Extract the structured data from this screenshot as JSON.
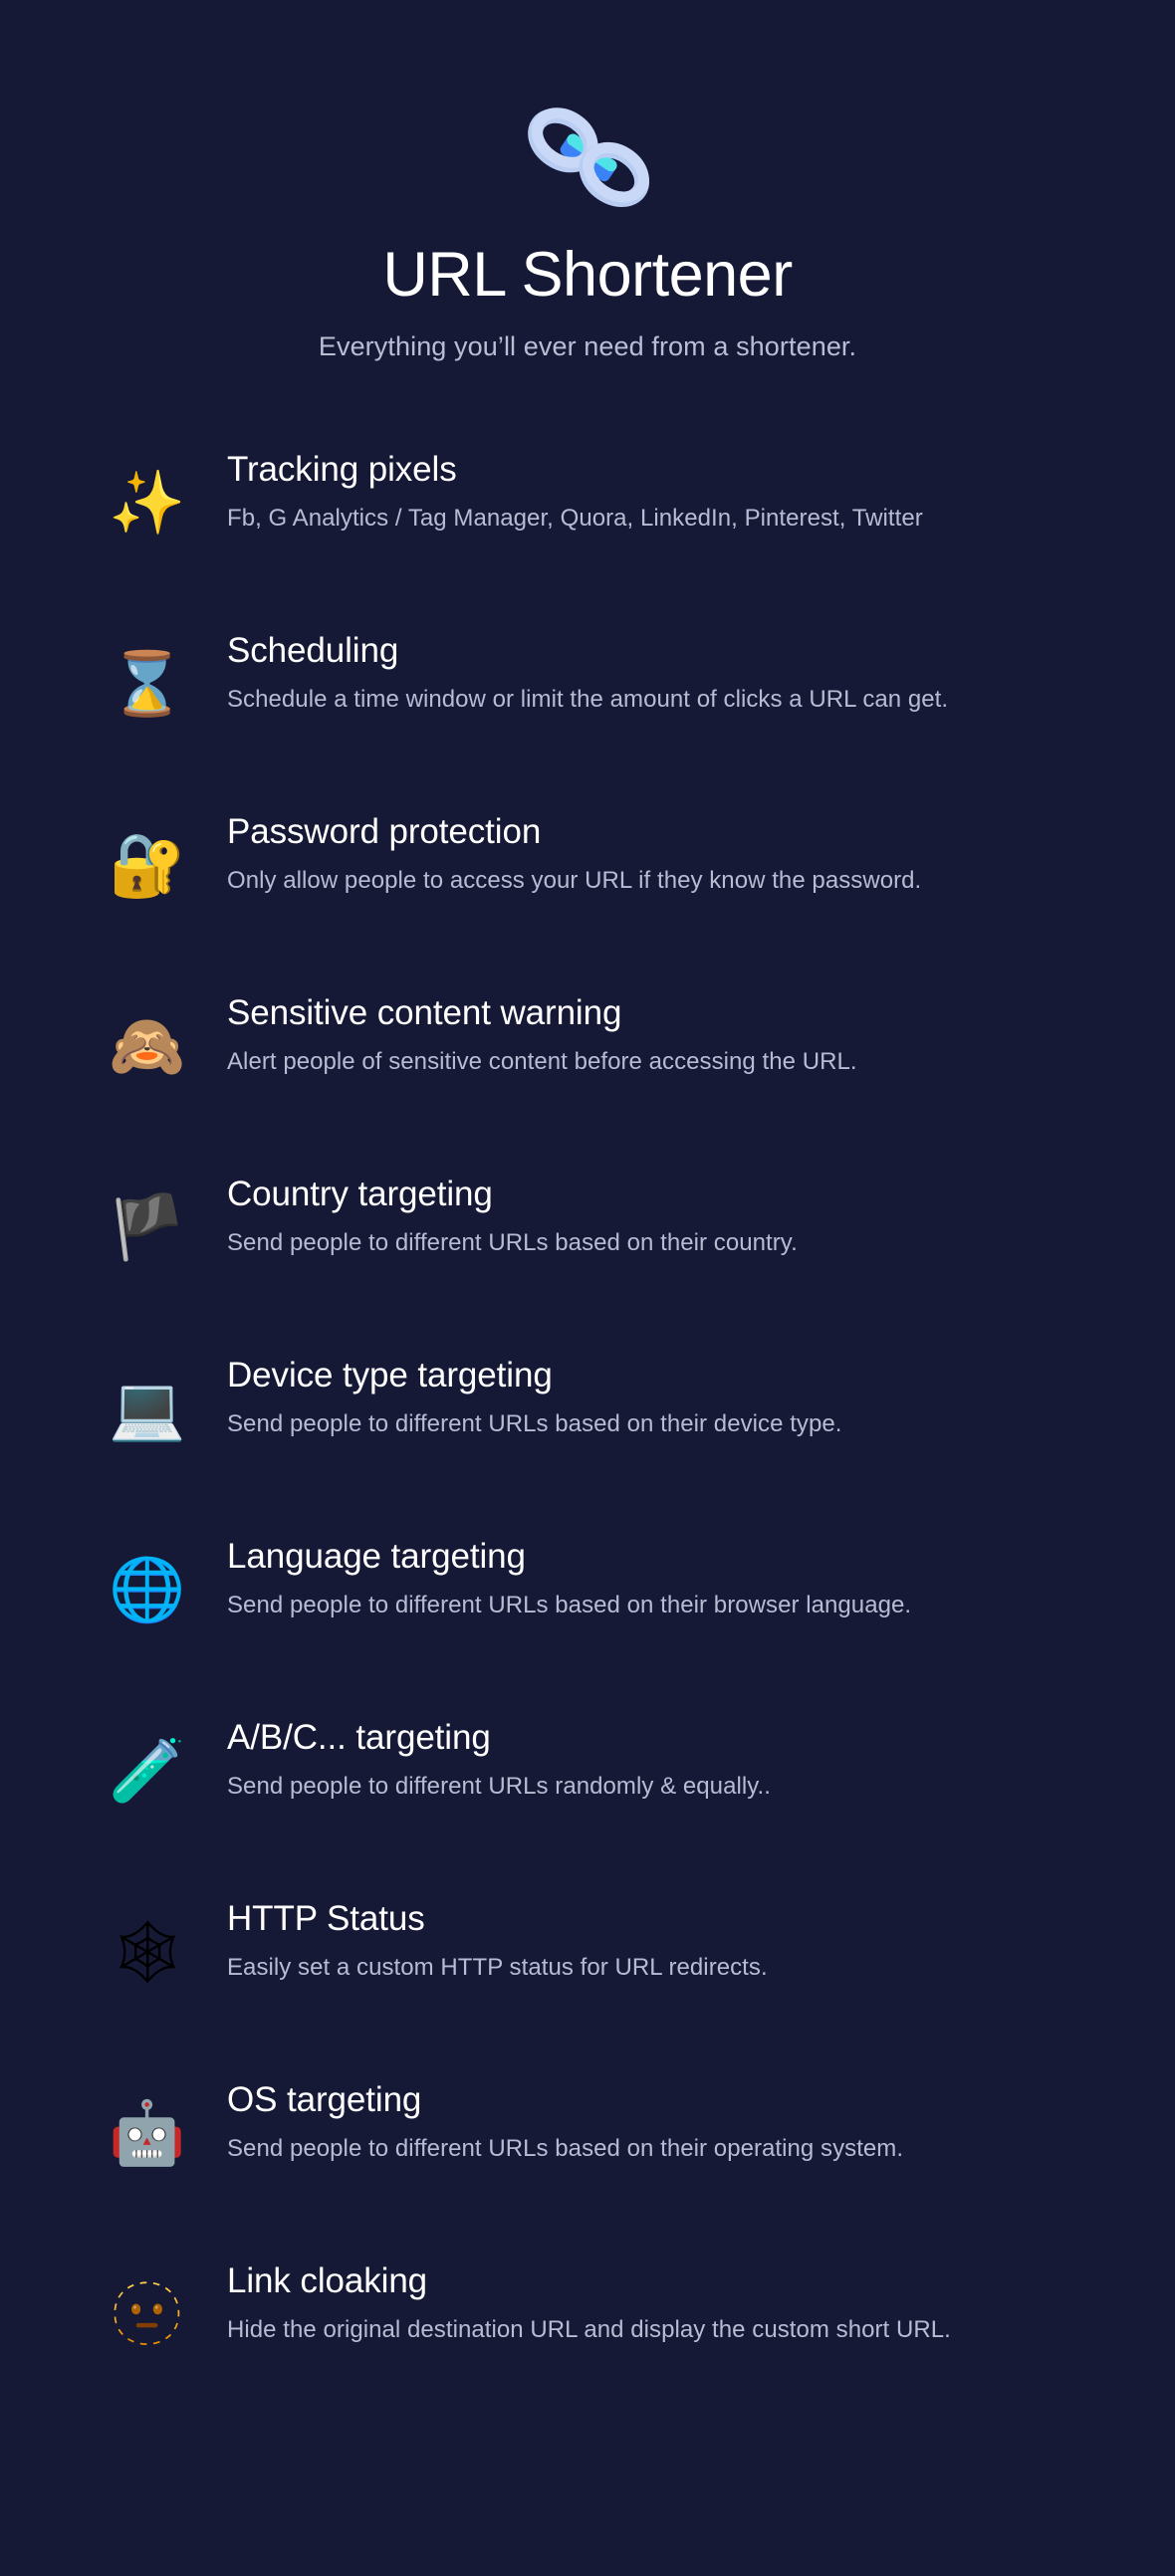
{
  "theme": {
    "background": "#161936",
    "title_color": "#ffffff",
    "subtitle_color": "#b9bed4",
    "description_color": "#b7bcd3",
    "logo_light": "#b9cdf2",
    "logo_mid": "#3b82f6",
    "logo_cyan": "#4fe3e8"
  },
  "header": {
    "logo_icon": "chain-link-icon",
    "title": "URL Shortener",
    "subtitle": "Everything you’ll ever need from a shortener."
  },
  "features": [
    {
      "icon": "sparkles-icon",
      "emoji": "✨",
      "title": "Tracking pixels",
      "description": "Fb, G Analytics / Tag Manager, Quora, LinkedIn, Pinterest, Twitter"
    },
    {
      "icon": "hourglass-icon",
      "emoji": "⌛",
      "title": "Scheduling",
      "description": "Schedule a time window or limit the amount of clicks a URL can get."
    },
    {
      "icon": "locked-with-key-icon",
      "emoji": "🔐",
      "title": "Password protection",
      "description": "Only allow people to access your URL if they know the password."
    },
    {
      "icon": "see-no-evil-monkey-icon",
      "emoji": "🙈",
      "title": "Sensitive content warning",
      "description": "Alert people of sensitive content before accessing the URL."
    },
    {
      "icon": "black-flag-icon",
      "emoji": "🏴",
      "title": "Country targeting",
      "description": "Send people to different URLs based on their country."
    },
    {
      "icon": "laptop-icon",
      "emoji": "💻",
      "title": "Device type targeting",
      "description": "Send people to different URLs based on their device type."
    },
    {
      "icon": "globe-with-meridians-icon",
      "emoji": "🌐",
      "title": "Language targeting",
      "description": "Send people to different URLs based on their browser language."
    },
    {
      "icon": "test-tube-icon",
      "emoji": "🧪",
      "title": "A/B/C... targeting",
      "description": "Send people to different URLs randomly & equally.."
    },
    {
      "icon": "spider-web-icon",
      "emoji": "🕸",
      "title": "HTTP Status",
      "description": "Easily set a custom HTTP status for URL redirects."
    },
    {
      "icon": "robot-icon",
      "emoji": "🤖",
      "title": "OS targeting",
      "description": "Send people to different URLs based on their operating system."
    },
    {
      "icon": "dotted-line-face-icon",
      "emoji": "🫥",
      "title": "Link cloaking",
      "description": "Hide the original destination URL and display the custom short URL."
    }
  ]
}
